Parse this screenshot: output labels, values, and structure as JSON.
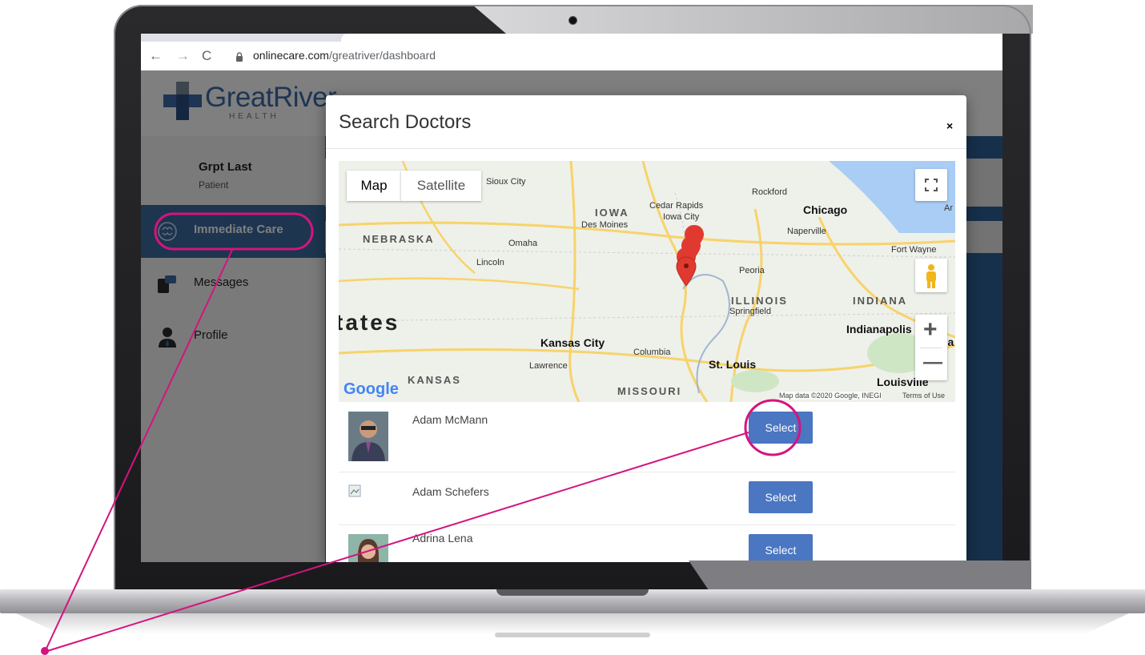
{
  "browser": {
    "url_host": "onlinecare.com",
    "url_path": "/greatriver/dashboard"
  },
  "app": {
    "logo_name": "GreatRiver",
    "logo_sub": "HEALTH",
    "user": {
      "name": "Grpt Last",
      "role": "Patient"
    },
    "sidebar": [
      {
        "label": "Immediate Care",
        "icon": "brain-icon",
        "active": true
      },
      {
        "label": "Messages",
        "icon": "chat-bubbles-icon",
        "active": false
      },
      {
        "label": "Profile",
        "icon": "person-icon",
        "active": false
      }
    ]
  },
  "modal": {
    "title": "Search Doctors",
    "close": "×",
    "map": {
      "type_buttons": [
        "Map",
        "Satellite"
      ],
      "labels": {
        "sioux_city": "Sioux City",
        "rockford": "Rockford",
        "chicago": "Chicago",
        "ar": "Ar",
        "iowa": "IOWA",
        "cedar_rapids": "Cedar Rapids",
        "iowa_city": "Iowa City",
        "des_moines": "Des Moines",
        "naperville": "Naperville",
        "nebraska": "NEBRASKA",
        "omaha": "Omaha",
        "fort_wayne": "Fort Wayne",
        "lincoln": "Lincoln",
        "peoria": "Peoria",
        "illinois": "ILLINOIS",
        "springfield": "Springfield",
        "indiana": "INDIANA",
        "states": "tates",
        "indianapolis": "Indianapolis",
        "na": "na",
        "kansas_city": "Kansas City",
        "columbia": "Columbia",
        "lawrence": "Lawrence",
        "st_louis": "St. Louis",
        "kansas": "KANSAS",
        "missouri": "MISSOURI",
        "louisville": "Louisville",
        "google": "Google",
        "attribution": "Map data ©2020 Google, INEGI",
        "terms": "Terms of Use"
      },
      "zoom_in": "+",
      "zoom_out": "—"
    },
    "doctors": [
      {
        "name": "Adam McMann",
        "button": "Select",
        "photo": "doctor-photo"
      },
      {
        "name": "Adam Schefers",
        "button": "Select",
        "photo": "broken-image-icon"
      },
      {
        "name": "Adrina Lena",
        "button": "Select",
        "photo": "doctor-photo"
      }
    ]
  },
  "colors": {
    "brand_blue": "#3a6b9e",
    "select_button": "#4a76c2",
    "annotation_magenta": "#d4147e",
    "map_pin": "#e03a30"
  }
}
